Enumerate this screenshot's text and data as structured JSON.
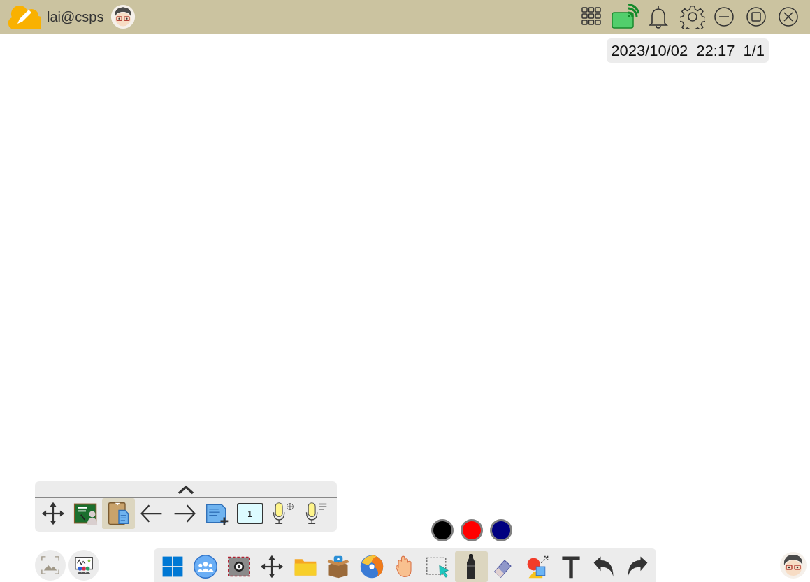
{
  "title_bar": {
    "user": "lai@csps"
  },
  "status": {
    "date": "2023/10/02",
    "time": "22:17",
    "page": "1/1"
  },
  "page_toolbar": {
    "tools": [
      {
        "kind": "move",
        "selected": false
      },
      {
        "kind": "teacher",
        "selected": false
      },
      {
        "kind": "clipboard",
        "selected": true
      },
      {
        "kind": "prev",
        "selected": false
      },
      {
        "kind": "next",
        "selected": false
      },
      {
        "kind": "addpage",
        "selected": false
      },
      {
        "kind": "pagenum",
        "selected": false,
        "label": "1"
      },
      {
        "kind": "micglobe",
        "selected": false
      },
      {
        "kind": "mictext",
        "selected": false
      }
    ]
  },
  "pen_colors": [
    {
      "color": "#000000"
    },
    {
      "color": "#ff0000"
    },
    {
      "color": "#000080"
    }
  ],
  "main_toolbar": {
    "tools": [
      {
        "kind": "windows",
        "selected": false
      },
      {
        "kind": "people",
        "selected": false
      },
      {
        "kind": "camera",
        "selected": false
      },
      {
        "kind": "move",
        "selected": false
      },
      {
        "kind": "folder",
        "selected": false
      },
      {
        "kind": "box",
        "selected": false
      },
      {
        "kind": "browser",
        "selected": false
      },
      {
        "kind": "hand",
        "selected": false
      },
      {
        "kind": "select",
        "selected": false
      },
      {
        "kind": "marker",
        "selected": true
      },
      {
        "kind": "eraser",
        "selected": false
      },
      {
        "kind": "shapes",
        "selected": false
      },
      {
        "kind": "text",
        "selected": false
      },
      {
        "kind": "undo",
        "selected": false
      },
      {
        "kind": "redo",
        "selected": false
      }
    ]
  }
}
